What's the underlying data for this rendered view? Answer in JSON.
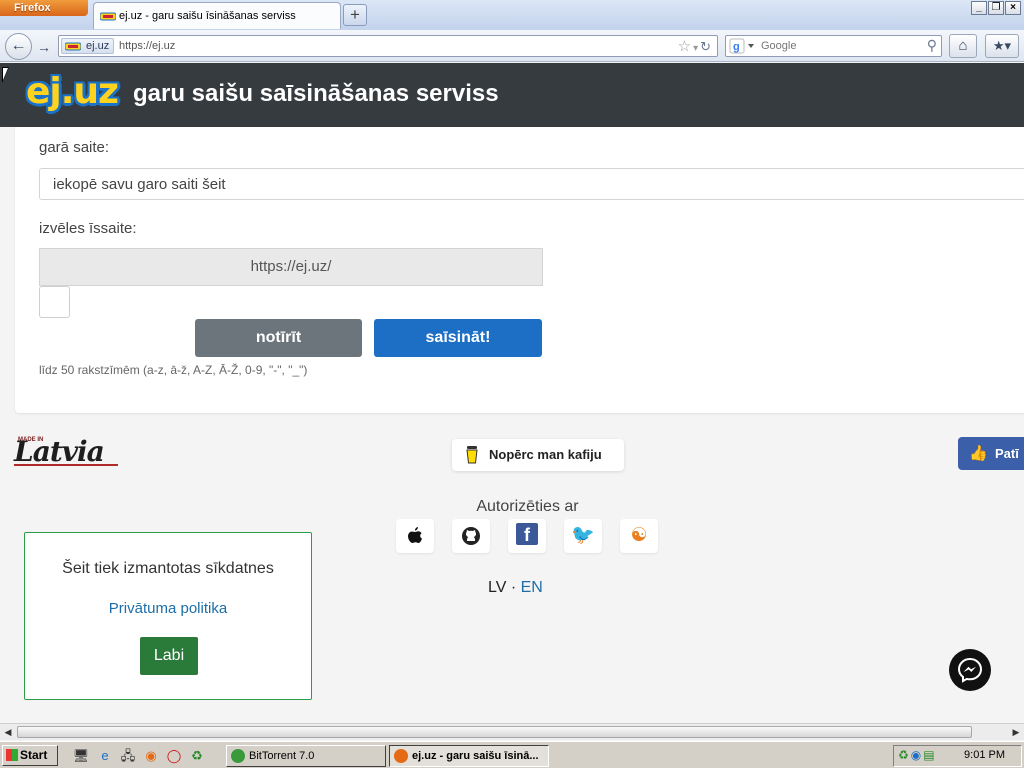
{
  "browser": {
    "app_menu": "Firefox",
    "tab_title": "ej.uz - garu saišu īsināšanas serviss",
    "new_tab": "+",
    "site_identity": "ej.uz",
    "url": "https://ej.uz",
    "search_placeholder": "Google",
    "window_minimize": "_",
    "window_restore": "❐",
    "window_close": "×"
  },
  "site": {
    "logo": "ej.uz",
    "title": "garu saišu saīsināšanas serviss",
    "long_url_label": "garā saite:",
    "long_url_placeholder": "iekopē savu garo saiti šeit",
    "alias_label": "izvēles īssaite:",
    "alias_prefix": "https://ej.uz/",
    "clear_button": "notīrīt",
    "shorten_button": "saīsināt!",
    "hint": "līdz 50 rakstzīmēm (a-z, ā-ž, A-Z, Ā-Ž, 0-9, \"-\", \"_\")"
  },
  "footer": {
    "made_in": "MADE IN",
    "latvia": "Latvia",
    "coffee_button": "Nopērc man kafiju",
    "like_button": "Patī",
    "auth_title": "Autorizēties ar",
    "social_icons": [
      "apple-icon",
      "github-icon",
      "facebook-icon",
      "twitter-icon",
      "draugiem-icon"
    ],
    "lang_lv": "LV",
    "lang_sep": "·",
    "lang_en": "EN"
  },
  "cookie": {
    "text": "Šeit tiek izmantotas sīkdatnes",
    "policy_link": "Privātuma politika",
    "ok_button": "Labi"
  },
  "taskbar": {
    "start": "Start",
    "items": [
      {
        "label": "BitTorrent 7.0",
        "active": false
      },
      {
        "label": "ej.uz - garu saišu īsinā...",
        "active": true
      }
    ],
    "clock": "9:01 PM"
  },
  "colors": {
    "header_bg": "#363b40",
    "primary_button": "#1d6ec5",
    "secondary_button": "#6c757c",
    "cookie_border": "#2f9c4a",
    "link": "#1d6ea8"
  }
}
